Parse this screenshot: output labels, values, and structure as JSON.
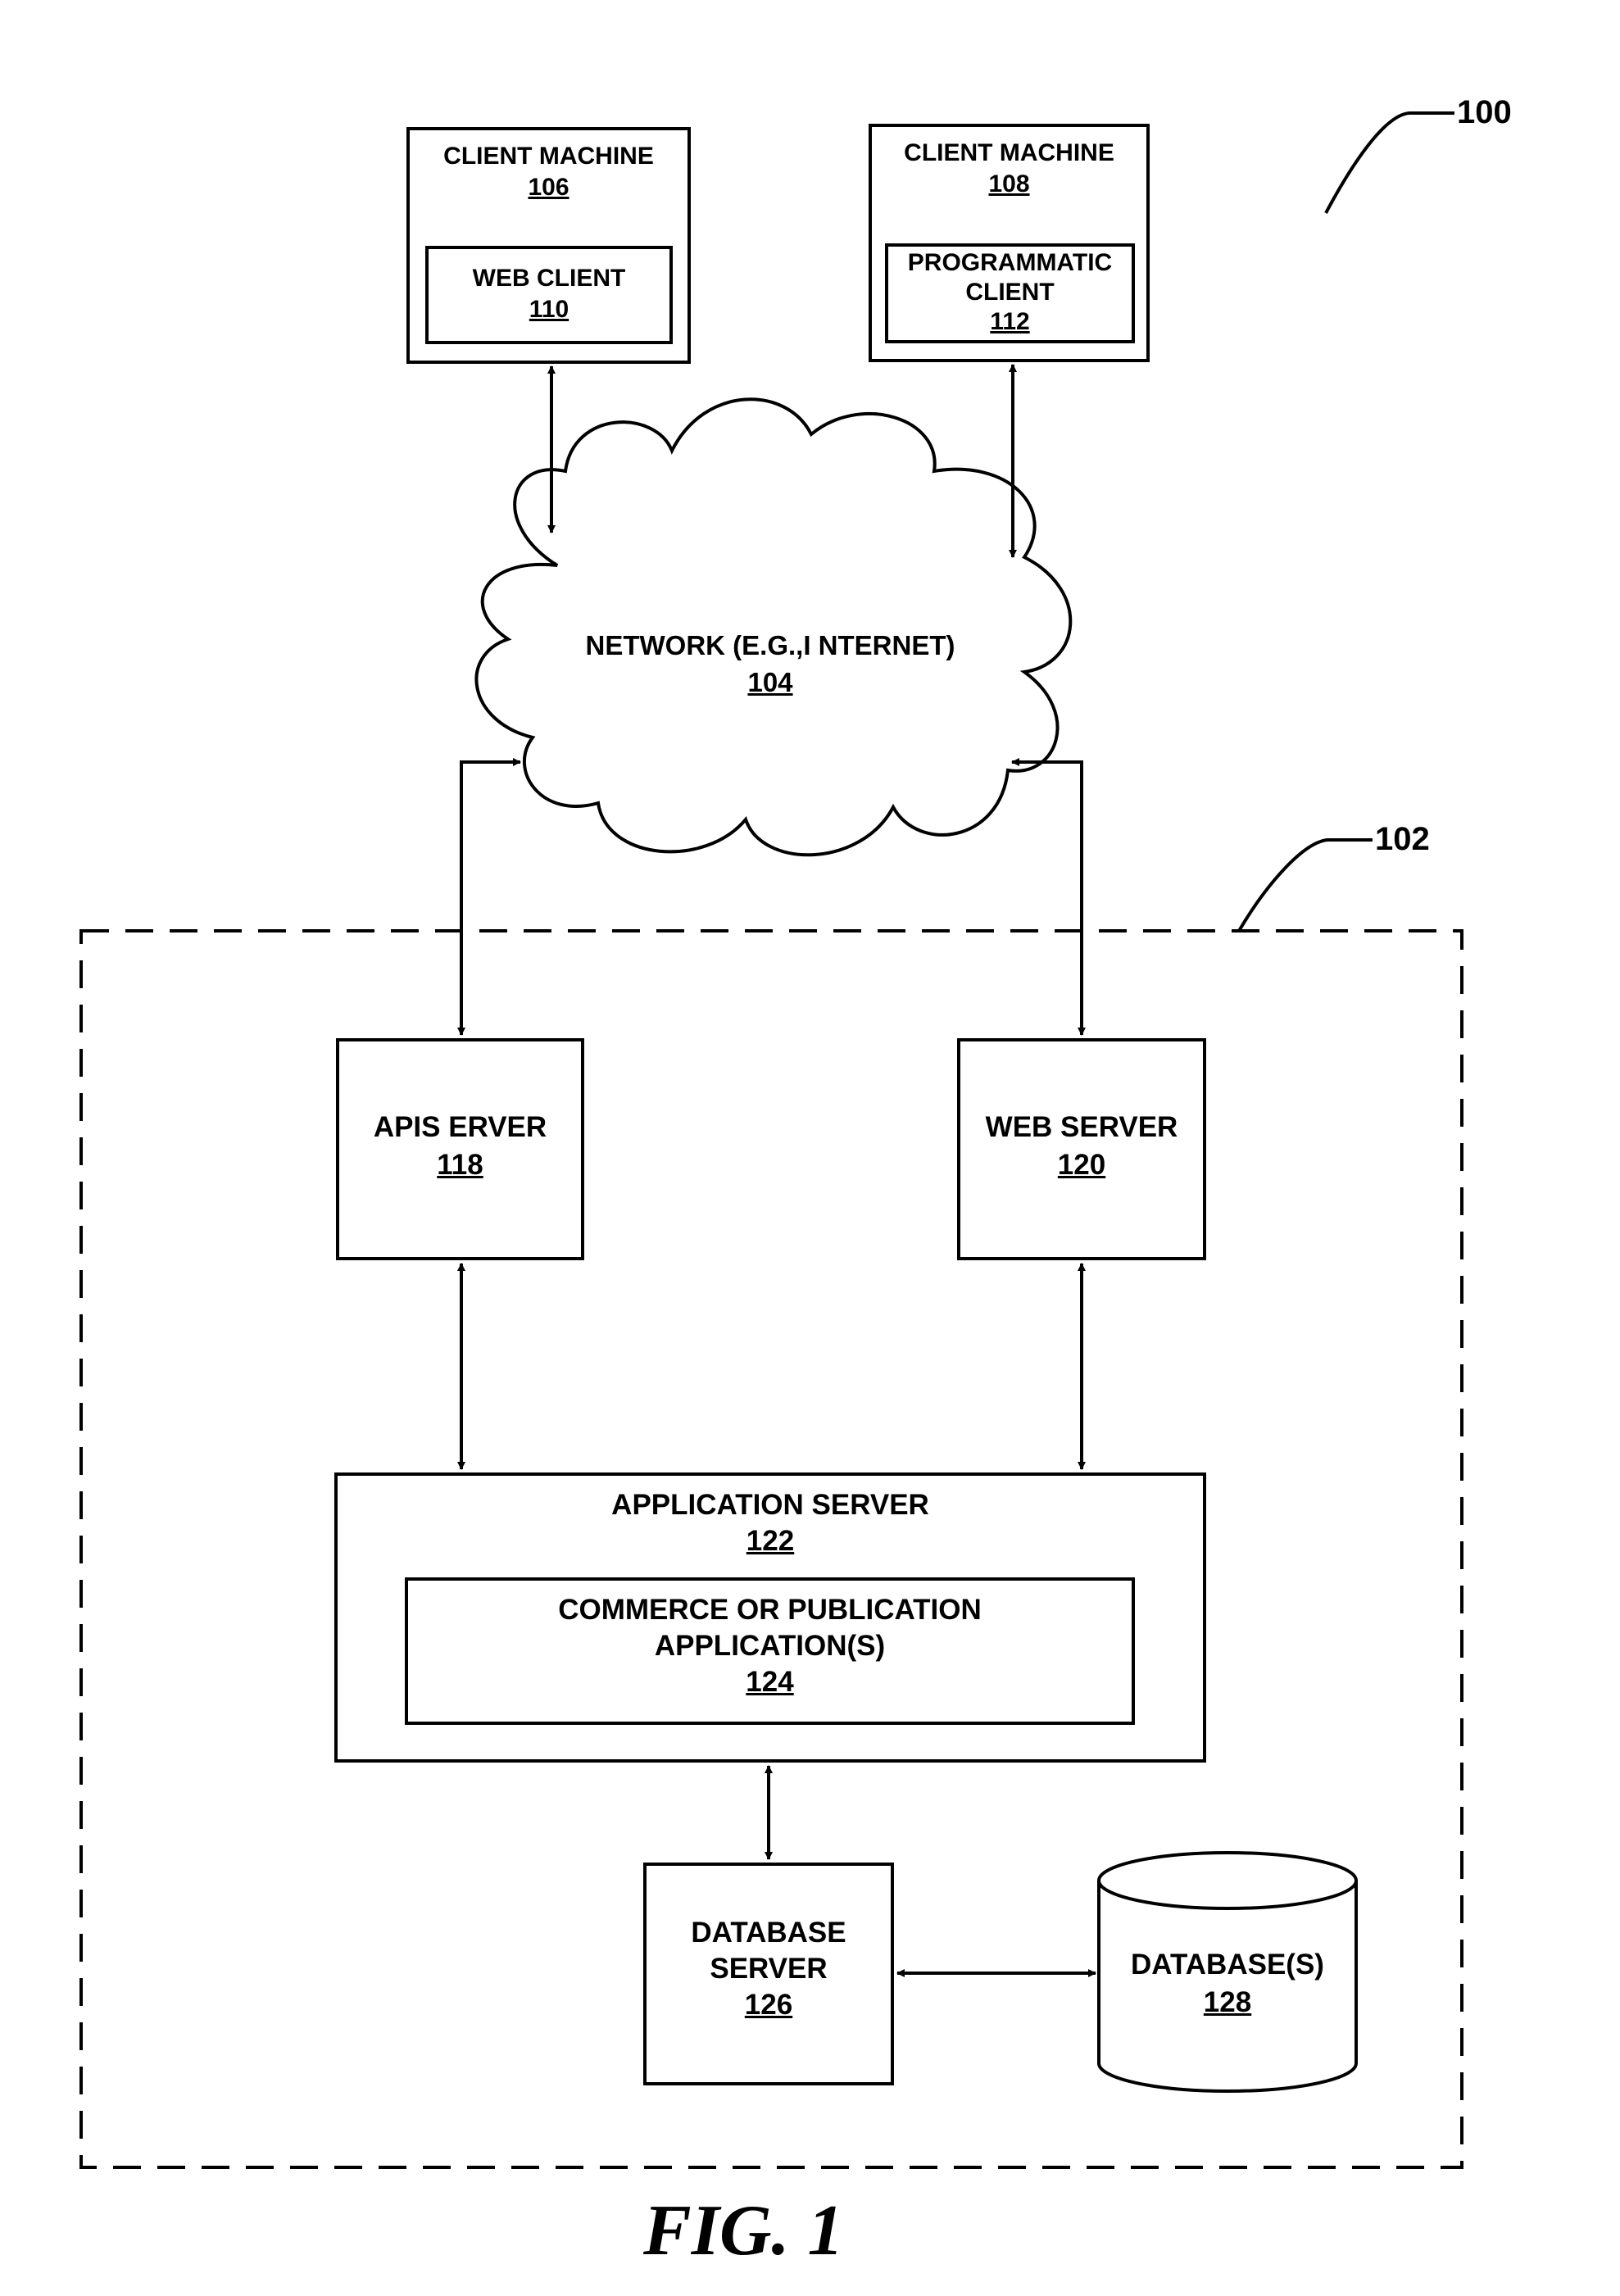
{
  "figure": {
    "caption": "FIG. 1",
    "system_ref": "100",
    "network_system_ref": "102"
  },
  "client_106": {
    "title": "CLIENT MACHINE",
    "num": "106",
    "inner_title": "WEB CLIENT",
    "inner_num": "110"
  },
  "client_108": {
    "title": "CLIENT MACHINE",
    "num": "108",
    "inner_title_1": "PROGRAMMATIC",
    "inner_title_2": "CLIENT",
    "inner_num": "112"
  },
  "network": {
    "title": "NETWORK (E.G.,I NTERNET)",
    "num": "104"
  },
  "api_server": {
    "title": "APIS ERVER",
    "num": "118"
  },
  "web_server": {
    "title": "WEB SERVER",
    "num": "120"
  },
  "app_server": {
    "title": "APPLICATION SERVER",
    "num": "122",
    "inner_title_1": "COMMERCE OR PUBLICATION",
    "inner_title_2": "APPLICATION(S)",
    "inner_num": "124"
  },
  "db_server": {
    "title_1": "DATABASE",
    "title_2": "SERVER",
    "num": "126"
  },
  "database": {
    "title": "DATABASE(S)",
    "num": "128"
  }
}
